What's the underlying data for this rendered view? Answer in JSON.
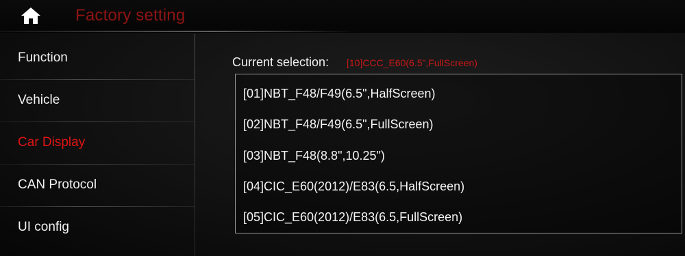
{
  "header": {
    "title": "Factory setting",
    "home_icon": "home-icon"
  },
  "sidebar": {
    "items": [
      {
        "label": "Function",
        "active": false
      },
      {
        "label": "Vehicle",
        "active": false
      },
      {
        "label": "Car Display",
        "active": true
      },
      {
        "label": "CAN Protocol",
        "active": false
      },
      {
        "label": "UI config",
        "active": false
      }
    ]
  },
  "main": {
    "current_selection_label": "Current selection:",
    "current_selection_value": "[10]CCC_E60(6.5\",FullScreen)",
    "options": [
      "[01]NBT_F48/F49(6.5\",HalfScreen)",
      "[02]NBT_F48/F49(6.5\",FullScreen)",
      "[03]NBT_F48(8.8\",10.25\")",
      "[04]CIC_E60(2012)/E83(6.5,HalfScreen)",
      "[05]CIC_E60(2012)/E83(6.5,FullScreen)"
    ]
  },
  "colors": {
    "accent_red": "#e01414",
    "title_red": "#8f1414",
    "background": "#111111"
  }
}
